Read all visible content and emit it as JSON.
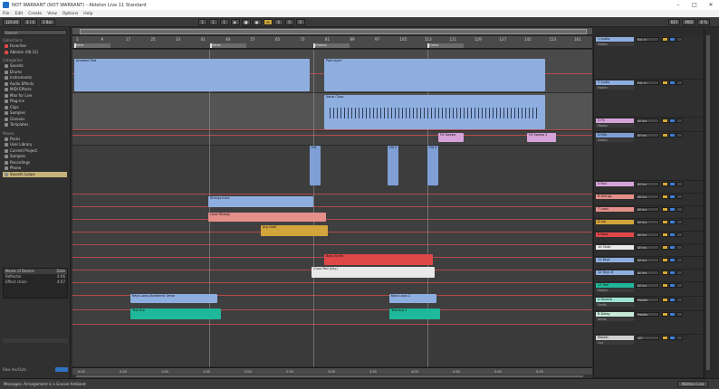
{
  "window": {
    "title": "NOT WARRANT (NOT WARRANT) - Ableton Live 11 Standard",
    "controls": [
      "–",
      "□",
      "✕"
    ]
  },
  "menu": [
    "File",
    "Edit",
    "Create",
    "View",
    "Options",
    "Help"
  ],
  "transport": {
    "tempo": "120.00",
    "signature": "4 / 4",
    "metronome": "1 Bar",
    "position": [
      "1",
      "1",
      "1"
    ],
    "loop_end": [
      "4",
      "0",
      "0"
    ],
    "right_buttons": [
      "KEY",
      "MIDI",
      "8 %"
    ]
  },
  "browser": {
    "search_placeholder": "Search",
    "collections_title": "Collections",
    "collections": [
      "Favorites",
      "Ableton (00:31)"
    ],
    "categories_title": "Categories",
    "categories": [
      "Sounds",
      "Drums",
      "Instruments",
      "Audio Effects",
      "MIDI Effects",
      "Max for Live",
      "Plug-ins",
      "Clips",
      "Samples",
      "Grooves",
      "Templates"
    ],
    "places_title": "Places",
    "places": [
      "Packs",
      "User Library",
      "Current Project",
      "Samples",
      "Recordings",
      "Phone",
      "Sounds Loops"
    ],
    "selected_place": "Sounds Loops",
    "fx_header": [
      "Name of Device",
      "Date"
    ],
    "fx_rows": [
      [
        "Reflector",
        "4:06"
      ],
      [
        "Effect chain",
        "4:07"
      ]
    ],
    "footer_label": "Raw Ins/Outs"
  },
  "arrangement": {
    "bar_labels": [
      "1",
      "9",
      "17",
      "25",
      "33",
      "41",
      "49",
      "57",
      "65",
      "73",
      "81",
      "89",
      "97",
      "105",
      "113",
      "121",
      "129",
      "137",
      "145",
      "153",
      "161"
    ],
    "locators": [
      "Intro",
      "Verse",
      "Chorus",
      "Outro"
    ],
    "time_labels": [
      "0:00",
      "0:30",
      "1:00",
      "1:30",
      "2:00",
      "2:30",
      "3:00",
      "3:30",
      "4:00",
      "4:30",
      "5:00",
      "5:30"
    ],
    "clips": [
      {
        "name": "Ambient Pad",
        "color": "#8eaee0"
      },
      {
        "name": "Pad Layer",
        "color": "#8eaee0"
      },
      {
        "name": "Vocal Chop",
        "color": "#8eaee0"
      },
      {
        "name": "FX Sweep",
        "color": "#d6a3d9"
      },
      {
        "name": "FX Sweep 2",
        "color": "#d6a3d9"
      },
      {
        "name": "Hit",
        "color": "#7f9fd6"
      },
      {
        "name": "Hit 2",
        "color": "#7f9fd6"
      },
      {
        "name": "Hit 3",
        "color": "#7f9fd6"
      },
      {
        "name": "Strings Intro",
        "color": "#8eaee0"
      },
      {
        "name": "Lead Melody",
        "color": "#e58f8a"
      },
      {
        "name": "Arp Gold",
        "color": "#d2a43c"
      },
      {
        "name": "Bass Synth",
        "color": "#e04848"
      },
      {
        "name": "Choir Pad (Dry)",
        "color": "#e8e8e8"
      },
      {
        "name": "Keys Loop (Ambient) Verse",
        "color": "#8eaee0"
      },
      {
        "name": "Keys Loop 2",
        "color": "#8eaee0"
      },
      {
        "name": "Teal Arp",
        "color": "#1fb89a"
      },
      {
        "name": "Teal Arp 2",
        "color": "#1fb89a"
      }
    ]
  },
  "mixer": {
    "tracks": [
      {
        "name": "1 Audio",
        "io": "Ext. In",
        "sub": "Master",
        "color": "#8eaee0"
      },
      {
        "name": "2 Audio",
        "io": "Ext. In",
        "sub": "Master",
        "color": "#8eaee0"
      },
      {
        "name": "3 FX",
        "io": "All Ins",
        "sub": "Master",
        "color": "#d6a3d9"
      },
      {
        "name": "4 Hits",
        "io": "All Ins",
        "sub": "Master",
        "color": "#7f9fd6"
      },
      {
        "name": "5 Pad",
        "io": "All Ins",
        "sub": "Master",
        "color": "#d6a3d9"
      },
      {
        "name": "6 Strings",
        "io": "All Ins",
        "sub": "Master",
        "color": "#e58f8a"
      },
      {
        "name": "7 Lead",
        "io": "All Ins",
        "sub": "Master",
        "color": "#e58f8a"
      },
      {
        "name": "8 Arp",
        "io": "All Ins",
        "sub": "Master",
        "color": "#d2a43c"
      },
      {
        "name": "9 Bass",
        "io": "All Ins",
        "sub": "Master",
        "color": "#e04848"
      },
      {
        "name": "10 Choir",
        "io": "All Ins",
        "sub": "Master",
        "color": "#e8e8e8"
      },
      {
        "name": "11 Keys",
        "io": "All Ins",
        "sub": "Master",
        "color": "#8eaee0"
      },
      {
        "name": "12 Keys B",
        "io": "All Ins",
        "sub": "Master",
        "color": "#8eaee0"
      },
      {
        "name": "13 Teal",
        "io": "All Ins",
        "sub": "Master",
        "color": "#1fb89a"
      },
      {
        "name": "A Reverb",
        "io": "Master",
        "sub": "Sends",
        "color": "#9fe3d5"
      },
      {
        "name": "B Delay",
        "io": "Master",
        "sub": "Sends",
        "color": "#c7ead8"
      },
      {
        "name": "Master",
        "io": "1/2",
        "sub": "Cue",
        "color": "#cfcfcf"
      }
    ]
  },
  "status": {
    "message": "Messages: Arrangement is a Groove Ambient",
    "right_label": "Ableton Live"
  }
}
